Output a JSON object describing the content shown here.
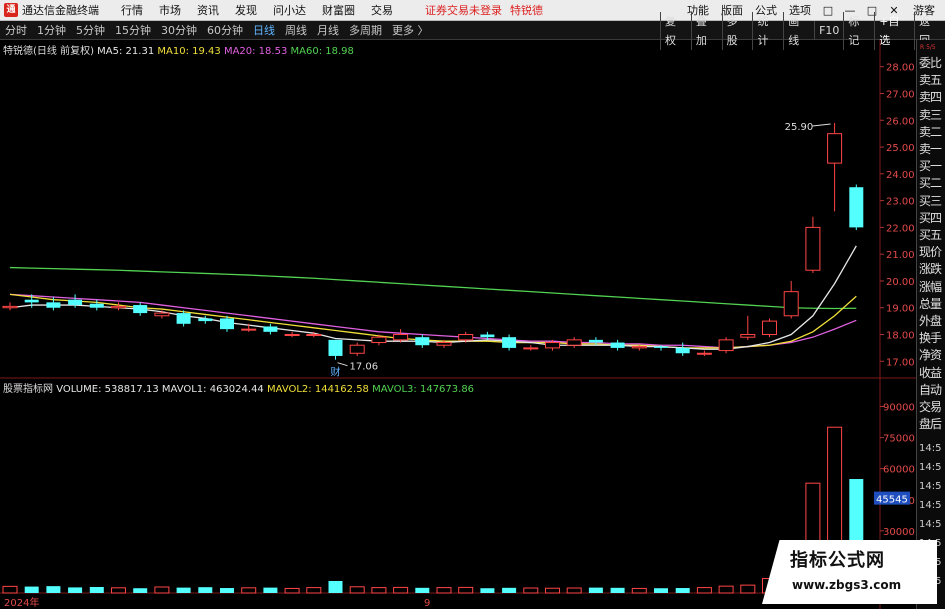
{
  "titlebar": {
    "logo_glyph": "通",
    "app_title": "通达信金融终端",
    "menus": [
      "行情",
      "市场",
      "资讯",
      "发现",
      "问小达",
      "财富圈",
      "交易"
    ],
    "notice": "证券交易未登录",
    "stock_name": "特锐德",
    "right_menus": [
      "功能",
      "版面",
      "公式",
      "选项"
    ],
    "win_buttons": [
      "□",
      "—",
      "□",
      "✕"
    ],
    "guest": "游客"
  },
  "periods": {
    "items": [
      "分时",
      "1分钟",
      "5分钟",
      "15分钟",
      "30分钟",
      "60分钟",
      "日线",
      "周线",
      "月线",
      "多周期",
      "更多 〉"
    ],
    "active": "日线",
    "toolbar": [
      "复权",
      "叠加",
      "多股",
      "统计",
      "画线",
      "F10",
      "标记",
      "+自选",
      "返回"
    ]
  },
  "kline_info": {
    "name": "特锐德(日线 前复权)",
    "ma5": "MA5: 21.31",
    "ma10": "MA10: 19.43",
    "ma20": "MA20: 18.53",
    "ma60": "MA60: 18.98"
  },
  "volume_info": {
    "name": "股票指标网",
    "volume": "VOLUME: 538817.13",
    "mavol1": "MAVOL1: 463024.44",
    "mavol2": "MAVOL2: 144162.58",
    "mavol3": "MAVOL3: 147673.86"
  },
  "price_axis": [
    "28.00",
    "27.00",
    "26.00",
    "25.00",
    "24.00",
    "23.00",
    "22.00",
    "21.00",
    "20.00",
    "19.00",
    "18.00",
    "17.00"
  ],
  "volume_axis": [
    "90000",
    "75000",
    "60000",
    "45000",
    "30000"
  ],
  "annotations": {
    "high": "25.90",
    "low": "17.06",
    "cai": "财",
    "vol_marker": "45545"
  },
  "time_axis": {
    "year": "2024年",
    "month": "9"
  },
  "sidebar": {
    "head": "R\n5/5",
    "items": [
      "委比",
      "卖五",
      "卖四",
      "卖三",
      "卖二",
      "卖一",
      "买一",
      "买二",
      "买三",
      "买四",
      "买五",
      "现价",
      "涨跌",
      "涨幅",
      "总量",
      "外盘",
      "换手",
      "净资",
      "收益",
      "自动",
      "交易",
      "盘后"
    ],
    "times": [
      "14:5",
      "14:5",
      "14:5",
      "14:5",
      "14:5",
      "14:5",
      "14:5",
      "14:5"
    ]
  },
  "watermark": {
    "title": "指标公式网",
    "url": "www.zbgs3.com"
  },
  "colors": {
    "up": "#ff4545",
    "down": "#54ffff",
    "ma5": "#e6e6e6",
    "ma10": "#f1df3a",
    "ma20": "#e060e0",
    "ma60": "#52d252"
  },
  "chart_data": {
    "type": "candlestick",
    "price_range": [
      16.6,
      28.4
    ],
    "candles": [
      {
        "o": 19.0,
        "c": 19.05,
        "h": 19.2,
        "l": 18.9
      },
      {
        "o": 19.3,
        "c": 19.2,
        "h": 19.5,
        "l": 19.0
      },
      {
        "o": 19.2,
        "c": 19.0,
        "h": 19.4,
        "l": 18.9
      },
      {
        "o": 19.3,
        "c": 19.1,
        "h": 19.5,
        "l": 19.0
      },
      {
        "o": 19.15,
        "c": 19.0,
        "h": 19.3,
        "l": 18.9
      },
      {
        "o": 19.0,
        "c": 19.05,
        "h": 19.2,
        "l": 18.9
      },
      {
        "o": 19.1,
        "c": 18.8,
        "h": 19.2,
        "l": 18.7
      },
      {
        "o": 18.7,
        "c": 18.8,
        "h": 18.9,
        "l": 18.6
      },
      {
        "o": 18.8,
        "c": 18.4,
        "h": 18.9,
        "l": 18.3
      },
      {
        "o": 18.6,
        "c": 18.5,
        "h": 18.7,
        "l": 18.4
      },
      {
        "o": 18.6,
        "c": 18.2,
        "h": 18.7,
        "l": 18.1
      },
      {
        "o": 18.2,
        "c": 18.2,
        "h": 18.4,
        "l": 18.1
      },
      {
        "o": 18.3,
        "c": 18.1,
        "h": 18.4,
        "l": 18.0
      },
      {
        "o": 18.0,
        "c": 18.0,
        "h": 18.1,
        "l": 17.9
      },
      {
        "o": 18.0,
        "c": 18.0,
        "h": 18.1,
        "l": 17.9
      },
      {
        "o": 17.8,
        "c": 17.2,
        "h": 17.8,
        "l": 17.06
      },
      {
        "o": 17.3,
        "c": 17.6,
        "h": 17.7,
        "l": 17.2
      },
      {
        "o": 17.7,
        "c": 17.9,
        "h": 18.0,
        "l": 17.6
      },
      {
        "o": 17.8,
        "c": 18.0,
        "h": 18.2,
        "l": 17.7
      },
      {
        "o": 17.9,
        "c": 17.6,
        "h": 18.0,
        "l": 17.5
      },
      {
        "o": 17.6,
        "c": 17.7,
        "h": 17.8,
        "l": 17.5
      },
      {
        "o": 17.8,
        "c": 18.0,
        "h": 18.1,
        "l": 17.7
      },
      {
        "o": 18.0,
        "c": 17.9,
        "h": 18.1,
        "l": 17.8
      },
      {
        "o": 17.9,
        "c": 17.5,
        "h": 18.0,
        "l": 17.4
      },
      {
        "o": 17.5,
        "c": 17.5,
        "h": 17.6,
        "l": 17.4
      },
      {
        "o": 17.5,
        "c": 17.7,
        "h": 17.8,
        "l": 17.4
      },
      {
        "o": 17.6,
        "c": 17.8,
        "h": 17.9,
        "l": 17.5
      },
      {
        "o": 17.8,
        "c": 17.7,
        "h": 17.9,
        "l": 17.6
      },
      {
        "o": 17.7,
        "c": 17.5,
        "h": 17.8,
        "l": 17.4
      },
      {
        "o": 17.5,
        "c": 17.55,
        "h": 17.6,
        "l": 17.4
      },
      {
        "o": 17.55,
        "c": 17.5,
        "h": 17.6,
        "l": 17.4
      },
      {
        "o": 17.5,
        "c": 17.3,
        "h": 17.7,
        "l": 17.2
      },
      {
        "o": 17.3,
        "c": 17.3,
        "h": 17.4,
        "l": 17.2
      },
      {
        "o": 17.4,
        "c": 17.8,
        "h": 17.9,
        "l": 17.3
      },
      {
        "o": 17.9,
        "c": 18.0,
        "h": 18.7,
        "l": 17.8
      },
      {
        "o": 18.0,
        "c": 18.5,
        "h": 18.6,
        "l": 17.9
      },
      {
        "o": 18.7,
        "c": 19.6,
        "h": 20.0,
        "l": 18.6
      },
      {
        "o": 20.4,
        "c": 22.0,
        "h": 22.4,
        "l": 20.3
      },
      {
        "o": 24.4,
        "c": 25.5,
        "h": 25.9,
        "l": 22.6
      },
      {
        "o": 23.5,
        "c": 22.0,
        "h": 23.6,
        "l": 21.9
      }
    ],
    "ma5": [
      19.0,
      19.1,
      19.1,
      19.1,
      19.05,
      19.0,
      18.95,
      18.85,
      18.7,
      18.6,
      18.45,
      18.35,
      18.25,
      18.15,
      18.05,
      17.85,
      17.8,
      17.75,
      17.75,
      17.75,
      17.7,
      17.75,
      17.8,
      17.75,
      17.7,
      17.6,
      17.6,
      17.6,
      17.6,
      17.55,
      17.55,
      17.5,
      17.45,
      17.45,
      17.55,
      17.7,
      18.0,
      18.7,
      19.9,
      21.31
    ],
    "ma10": [
      19.5,
      19.4,
      19.3,
      19.25,
      19.2,
      19.1,
      19.0,
      18.95,
      18.85,
      18.75,
      18.65,
      18.55,
      18.45,
      18.35,
      18.25,
      18.15,
      18.05,
      17.95,
      17.85,
      17.8,
      17.75,
      17.75,
      17.75,
      17.7,
      17.7,
      17.7,
      17.65,
      17.65,
      17.6,
      17.6,
      17.55,
      17.5,
      17.5,
      17.5,
      17.55,
      17.6,
      17.75,
      18.1,
      18.7,
      19.43
    ],
    "ma20": [
      19.5,
      19.45,
      19.4,
      19.35,
      19.3,
      19.25,
      19.2,
      19.1,
      19.0,
      18.9,
      18.8,
      18.7,
      18.6,
      18.5,
      18.4,
      18.3,
      18.2,
      18.1,
      18.05,
      18.0,
      17.95,
      17.9,
      17.85,
      17.8,
      17.75,
      17.75,
      17.7,
      17.7,
      17.65,
      17.65,
      17.6,
      17.6,
      17.55,
      17.5,
      17.55,
      17.6,
      17.7,
      17.9,
      18.2,
      18.53
    ],
    "ma60": [
      20.5,
      20.48,
      20.46,
      20.44,
      20.42,
      20.4,
      20.37,
      20.34,
      20.31,
      20.28,
      20.25,
      20.22,
      20.18,
      20.14,
      20.1,
      20.05,
      20.0,
      19.95,
      19.9,
      19.85,
      19.8,
      19.75,
      19.7,
      19.65,
      19.6,
      19.55,
      19.5,
      19.45,
      19.4,
      19.35,
      19.3,
      19.25,
      19.2,
      19.15,
      19.1,
      19.05,
      19.0,
      18.98,
      18.97,
      18.98
    ],
    "volume_range": [
      0,
      97000
    ],
    "volumes": [
      3200,
      3100,
      3300,
      2700,
      2900,
      2500,
      2300,
      2900,
      2600,
      2800,
      2400,
      2500,
      2600,
      2200,
      2600,
      5800,
      3000,
      2600,
      2700,
      2500,
      2600,
      2700,
      2300,
      2500,
      2400,
      2300,
      2400,
      2600,
      2500,
      2200,
      2300,
      2400,
      2600,
      3300,
      3800,
      7000,
      25000,
      53000,
      80000,
      55000
    ]
  }
}
